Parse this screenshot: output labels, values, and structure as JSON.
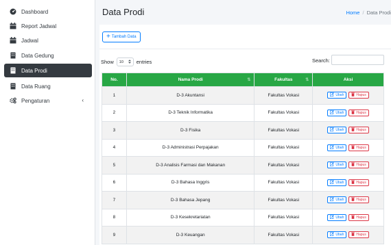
{
  "sidebar": {
    "items": [
      {
        "label": "Dashboard",
        "icon": "dashboard-icon",
        "active": false
      },
      {
        "label": "Report Jadwal",
        "icon": "calendar-icon",
        "active": false
      },
      {
        "label": "Jadwal",
        "icon": "calendar-icon",
        "active": false
      },
      {
        "label": "Data Gedung",
        "icon": "building-icon",
        "active": false
      },
      {
        "label": "Data Prodi",
        "icon": "building-icon",
        "active": true
      },
      {
        "label": "Data Ruang",
        "icon": "building-icon",
        "active": false
      },
      {
        "label": "Pengaturan",
        "icon": "gears-icon",
        "active": false,
        "chevron": "‹"
      }
    ]
  },
  "header": {
    "title": "Data Prodi",
    "breadcrumb": {
      "home": "Home",
      "separator": "/",
      "current": "Data Prodi"
    }
  },
  "toolbar": {
    "add_label": "Tambah Data"
  },
  "controls": {
    "show_prefix": "Show",
    "entries_value": "10",
    "show_suffix": "entries",
    "search_label": "Search:",
    "search_value": ""
  },
  "table": {
    "columns": [
      "No.",
      "Nama Prodi",
      "Fakultas",
      "Aksi"
    ],
    "action_edit": "Ubah",
    "action_delete": "Hapus",
    "rows": [
      {
        "no": "1",
        "nama": "D-3 Akuntansi",
        "fakultas": "Fakultas Vokasi"
      },
      {
        "no": "2",
        "nama": "D-3 Teknik Informatika",
        "fakultas": "Fakultas Vokasi"
      },
      {
        "no": "3",
        "nama": "D-3 Fisika",
        "fakultas": "Fakultas Vokasi"
      },
      {
        "no": "4",
        "nama": "D-3 Administrasi Perpajakan",
        "fakultas": "Fakultas Vokasi"
      },
      {
        "no": "5",
        "nama": "D-3 Analisis Farmasi dan Makanan",
        "fakultas": "Fakultas Vokasi"
      },
      {
        "no": "6",
        "nama": "D-3 Bahasa Inggris",
        "fakultas": "Fakultas Vokasi"
      },
      {
        "no": "7",
        "nama": "D-3 Bahasa Jepang",
        "fakultas": "Fakultas Vokasi"
      },
      {
        "no": "8",
        "nama": "D-3 Kesekretariatan",
        "fakultas": "Fakultas Vokasi"
      },
      {
        "no": "9",
        "nama": "D-3 Keuangan",
        "fakultas": "Fakultas Vokasi"
      }
    ]
  },
  "colors": {
    "header_green": "#28a745",
    "active_nav": "#343a40",
    "link_blue": "#007bff",
    "danger_red": "#dc3545"
  }
}
